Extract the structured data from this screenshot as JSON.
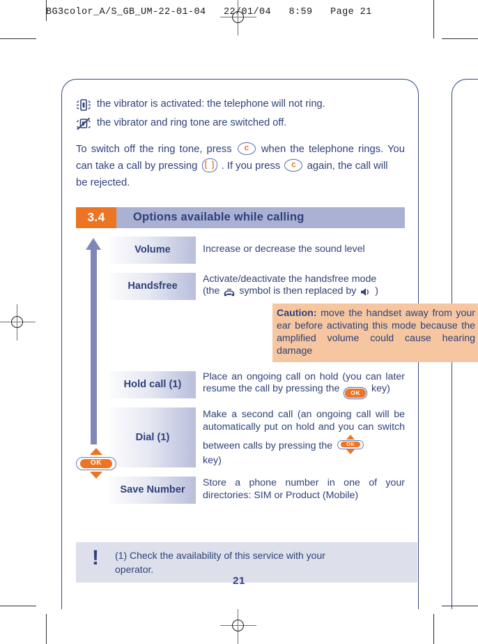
{
  "print_slug": "BG3color_A/S_GB_UM-22-01-04   22/01/04   8:59   Page 21",
  "colors": {
    "ink_blue": "#2f4179",
    "accent_orange": "#ed7422",
    "heading_bar": "#abb1d2",
    "caution_bg": "#f5c6a0",
    "footnote_bg": "#dde0ea",
    "arrow": "#7d88b8"
  },
  "bullets": [
    {
      "icon": "vibrator-on-icon",
      "text": "the vibrator is activated: the telephone will not ring."
    },
    {
      "icon": "vibrator-and-ring-off-icon",
      "text": "the vibrator and ring tone are switched off."
    }
  ],
  "intro": {
    "seg1": "To switch off the ring tone, press",
    "key1": "c",
    "seg2": "when the telephone rings. You can take a call by pressing",
    "key2": "send",
    "seg3": ". If you press",
    "key3": "c",
    "seg4": "again, the call will",
    "seg5": "be rejected."
  },
  "section": {
    "number": "3.4",
    "title": "Options available while calling"
  },
  "options": [
    {
      "label": "Volume",
      "desc": "Increase or decrease the sound level"
    },
    {
      "label": "Handsfree",
      "desc_line1": "Activate/deactivate the handsfree mode",
      "desc_pre": "(the",
      "desc_mid": "symbol is then replaced by",
      "desc_post": ")",
      "symbol_from": "telephone-icon",
      "symbol_to": "speaker-icon"
    },
    {
      "label": "Hold call (1)",
      "desc_pre": "Place an ongoing call on hold (you can later resume the call by pressing the",
      "key": "OK",
      "desc_post": "key)"
    },
    {
      "label": "Dial (1)",
      "desc_pre": "Make a second call (an ongoing call will be automatically put on hold and you can switch between calls by pressing the",
      "key": "OK",
      "desc_post": "key)"
    },
    {
      "label": "Save Number",
      "desc": "Store a phone number in one of your directories: SIM or Product (Mobile)"
    }
  ],
  "caution": {
    "label": "Caution:",
    "text": " move the handset away from your ear before activating this mode because the amplified volume could cause hearing damage"
  },
  "nav_key": {
    "ok_label": "OK"
  },
  "footnote": {
    "mark": "!",
    "line1": "(1) Check the availability of this service with your",
    "line2": "operator."
  },
  "page_number": "21"
}
